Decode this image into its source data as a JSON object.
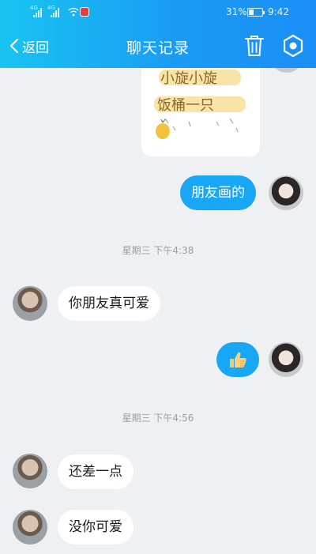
{
  "status_bar": {
    "signal_1": "4G",
    "signal_2": "4G",
    "battery_percent": "31%",
    "battery_level": 0.31,
    "time": "9:42"
  },
  "header": {
    "back_label": "返回",
    "title": "聊天记录",
    "icons": [
      "chevron-left-icon",
      "trash-icon",
      "settings-hexagon-icon"
    ],
    "background_colors": [
      "#19c4f1",
      "#1a8ef6"
    ]
  },
  "messages": [
    {
      "id": "m1",
      "sender": "friend",
      "type": "image",
      "drawing_text": [
        "小旋小旋",
        "饭桶一只"
      ]
    },
    {
      "id": "m2",
      "sender": "me",
      "type": "text",
      "text": "朋友画的"
    },
    {
      "id": "t1",
      "type": "timestamp",
      "text": "星期三 下午4:38"
    },
    {
      "id": "m3",
      "sender": "other",
      "type": "text",
      "text": "你朋友真可爱"
    },
    {
      "id": "m4",
      "sender": "me",
      "type": "emoji",
      "emoji": "thumbs-up-icon"
    },
    {
      "id": "t2",
      "type": "timestamp",
      "text": "星期三 下午4:56"
    },
    {
      "id": "m5",
      "sender": "other",
      "type": "text",
      "text": "还差一点"
    },
    {
      "id": "m6",
      "sender": "other",
      "type": "text",
      "text": "没你可爱"
    }
  ],
  "colors": {
    "outgoing_bubble": "#18a7f7",
    "incoming_bubble": "#ffffff",
    "chat_background": "#eef0f4"
  }
}
